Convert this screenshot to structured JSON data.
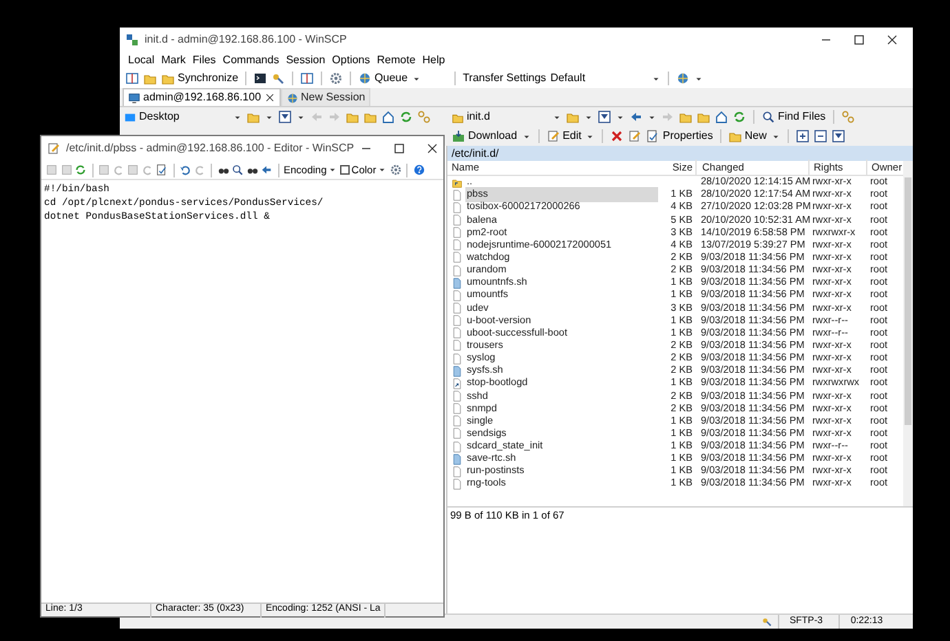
{
  "main_window": {
    "title": "init.d - admin@192.168.86.100 - WinSCP",
    "menu": [
      "Local",
      "Mark",
      "Files",
      "Commands",
      "Session",
      "Options",
      "Remote",
      "Help"
    ],
    "toolbar": {
      "synchronize": "Synchronize",
      "queue": "Queue",
      "transfer_label": "Transfer Settings",
      "transfer_value": "Default"
    },
    "tabs": [
      {
        "label": "admin@192.168.86.100",
        "selected": true
      },
      {
        "label": "New Session",
        "selected": false
      }
    ],
    "local_path": "Desktop",
    "remote_path": "init.d",
    "find_files": "Find Files",
    "remote_actions": [
      "Download",
      "Edit",
      "Properties",
      "New"
    ],
    "remote_dir": "/etc/init.d/",
    "columns": [
      "Name",
      "Size",
      "Changed",
      "Rights",
      "Owner"
    ],
    "files": [
      {
        "kind": "parent",
        "name": "..",
        "changed": "28/10/2020 12:14:15 AM",
        "rights": "rwxr-xr-x",
        "owner": "root",
        "selected": false
      },
      {
        "kind": "file",
        "name": "pbss",
        "size": "1 KB",
        "changed": "28/10/2020 12:17:54 AM",
        "rights": "rwxr-xr-x",
        "owner": "root",
        "selected": true
      },
      {
        "kind": "file",
        "name": "tosibox-60002172000266",
        "size": "4 KB",
        "changed": "27/10/2020 12:03:28 PM",
        "rights": "rwxr-xr-x",
        "owner": "root",
        "selected": false
      },
      {
        "kind": "file",
        "name": "balena",
        "size": "5 KB",
        "changed": "20/10/2020 10:52:31 AM",
        "rights": "rwxr-xr-x",
        "owner": "root",
        "selected": false
      },
      {
        "kind": "file",
        "name": "pm2-root",
        "size": "3 KB",
        "changed": "14/10/2019 6:58:58 PM",
        "rights": "rwxrwxr-x",
        "owner": "root",
        "selected": false
      },
      {
        "kind": "file",
        "name": "nodejsruntime-60002172000051",
        "size": "4 KB",
        "changed": "13/07/2019 5:39:27 PM",
        "rights": "rwxr-xr-x",
        "owner": "root",
        "selected": false
      },
      {
        "kind": "file",
        "name": "watchdog",
        "size": "2 KB",
        "changed": "9/03/2018 11:34:56 PM",
        "rights": "rwxr-xr-x",
        "owner": "root",
        "selected": false
      },
      {
        "kind": "file",
        "name": "urandom",
        "size": "2 KB",
        "changed": "9/03/2018 11:34:56 PM",
        "rights": "rwxr-xr-x",
        "owner": "root",
        "selected": false
      },
      {
        "kind": "script",
        "name": "umountnfs.sh",
        "size": "1 KB",
        "changed": "9/03/2018 11:34:56 PM",
        "rights": "rwxr-xr-x",
        "owner": "root",
        "selected": false
      },
      {
        "kind": "file",
        "name": "umountfs",
        "size": "1 KB",
        "changed": "9/03/2018 11:34:56 PM",
        "rights": "rwxr-xr-x",
        "owner": "root",
        "selected": false
      },
      {
        "kind": "file",
        "name": "udev",
        "size": "3 KB",
        "changed": "9/03/2018 11:34:56 PM",
        "rights": "rwxr-xr-x",
        "owner": "root",
        "selected": false
      },
      {
        "kind": "file",
        "name": "u-boot-version",
        "size": "1 KB",
        "changed": "9/03/2018 11:34:56 PM",
        "rights": "rwxr--r--",
        "owner": "root",
        "selected": false
      },
      {
        "kind": "file",
        "name": "uboot-successfull-boot",
        "size": "1 KB",
        "changed": "9/03/2018 11:34:56 PM",
        "rights": "rwxr--r--",
        "owner": "root",
        "selected": false
      },
      {
        "kind": "file",
        "name": "trousers",
        "size": "2 KB",
        "changed": "9/03/2018 11:34:56 PM",
        "rights": "rwxr-xr-x",
        "owner": "root",
        "selected": false
      },
      {
        "kind": "file",
        "name": "syslog",
        "size": "2 KB",
        "changed": "9/03/2018 11:34:56 PM",
        "rights": "rwxr-xr-x",
        "owner": "root",
        "selected": false
      },
      {
        "kind": "script",
        "name": "sysfs.sh",
        "size": "2 KB",
        "changed": "9/03/2018 11:34:56 PM",
        "rights": "rwxr-xr-x",
        "owner": "root",
        "selected": false
      },
      {
        "kind": "link",
        "name": "stop-bootlogd",
        "size": "1 KB",
        "changed": "9/03/2018 11:34:56 PM",
        "rights": "rwxrwxrwx",
        "owner": "root",
        "selected": false
      },
      {
        "kind": "file",
        "name": "sshd",
        "size": "2 KB",
        "changed": "9/03/2018 11:34:56 PM",
        "rights": "rwxr-xr-x",
        "owner": "root",
        "selected": false
      },
      {
        "kind": "file",
        "name": "snmpd",
        "size": "2 KB",
        "changed": "9/03/2018 11:34:56 PM",
        "rights": "rwxr-xr-x",
        "owner": "root",
        "selected": false
      },
      {
        "kind": "file",
        "name": "single",
        "size": "1 KB",
        "changed": "9/03/2018 11:34:56 PM",
        "rights": "rwxr-xr-x",
        "owner": "root",
        "selected": false
      },
      {
        "kind": "file",
        "name": "sendsigs",
        "size": "1 KB",
        "changed": "9/03/2018 11:34:56 PM",
        "rights": "rwxr-xr-x",
        "owner": "root",
        "selected": false
      },
      {
        "kind": "file",
        "name": "sdcard_state_init",
        "size": "1 KB",
        "changed": "9/03/2018 11:34:56 PM",
        "rights": "rwxr--r--",
        "owner": "root",
        "selected": false
      },
      {
        "kind": "script",
        "name": "save-rtc.sh",
        "size": "1 KB",
        "changed": "9/03/2018 11:34:56 PM",
        "rights": "rwxr-xr-x",
        "owner": "root",
        "selected": false
      },
      {
        "kind": "file",
        "name": "run-postinsts",
        "size": "1 KB",
        "changed": "9/03/2018 11:34:56 PM",
        "rights": "rwxr-xr-x",
        "owner": "root",
        "selected": false
      },
      {
        "kind": "file",
        "name": "rng-tools",
        "size": "1 KB",
        "changed": "9/03/2018 11:34:56 PM",
        "rights": "rwxr-xr-x",
        "owner": "root",
        "selected": false
      }
    ],
    "selection_status": "99 B of 110 KB in 1 of 67",
    "status_bar": [
      "SFTP-3",
      "0:22:13"
    ]
  },
  "editor": {
    "title": "/etc/init.d/pbss - admin@192.168.86.100 - Editor - WinSCP",
    "encoding": "Encoding",
    "color": {
      "label": "Color",
      "checked": false
    },
    "lines": [
      "#!/bin/bash",
      "cd /opt/plcnext/pondus-services/PondusServices/",
      "dotnet PondusBaseStationServices.dll &"
    ],
    "status": [
      "Line: 1/3",
      "Character: 35 (0x23)",
      "Encoding: 1252  (ANSI - La"
    ]
  }
}
